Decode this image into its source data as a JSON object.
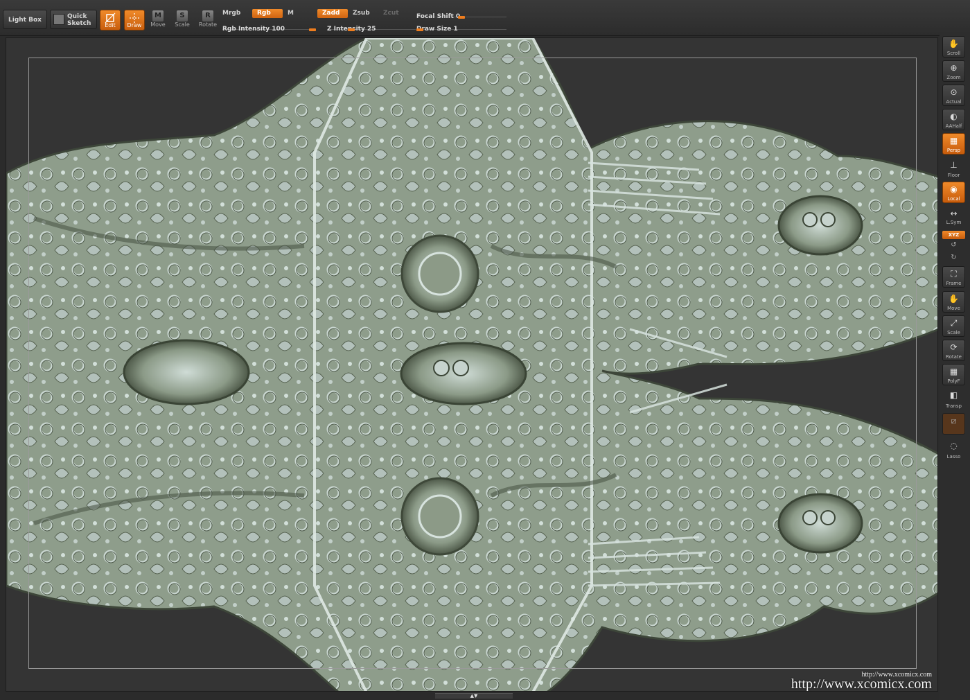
{
  "toolbar": {
    "light_box": "Light Box",
    "quick_sketch_line1": "Quick",
    "quick_sketch_line2": "Sketch",
    "edit": "Edit",
    "draw": "Draw",
    "move": "Move",
    "scale": "Scale",
    "rotate": "Rotate",
    "move_glyph": "M",
    "scale_glyph": "S",
    "rotate_glyph": "R",
    "mrgb": "Mrgb",
    "rgb": "Rgb",
    "m": "M",
    "zadd": "Zadd",
    "zsub": "Zsub",
    "zcut": "Zcut",
    "rgb_intensity": "Rgb Intensity 100",
    "z_intensity": "Z Intensity 25",
    "focal_shift": "Focal Shift 0",
    "draw_size": "Draw Size 1"
  },
  "slider_values": {
    "rgb_intensity": 100,
    "z_intensity": 25,
    "focal_shift": 0,
    "draw_size": 1
  },
  "shelf": {
    "scroll": "Scroll",
    "zoom": "Zoom",
    "actual": "Actual",
    "aahalf": "AAHalf",
    "persp": "Persp",
    "floor": "Floor",
    "local": "Local",
    "lsym": "L.Sym",
    "xyz": "XYZ",
    "frame": "Frame",
    "move": "Move",
    "scale": "Scale",
    "rotate": "Rotate",
    "polyf": "PolyF",
    "transp": "Transp",
    "lasso": "Lasso"
  },
  "watermark": {
    "small": "http://www.xcomicx.com",
    "big": "http://www.xcomicx.com"
  },
  "icons": [
    "hand-icon",
    "magnifier-icon",
    "perspective-icon",
    "floor-icon",
    "local-icon",
    "symmetry-icon",
    "frame-icon",
    "move-icon",
    "scale-icon",
    "rotate-icon",
    "polyframe-icon",
    "transparency-icon",
    "lasso-icon",
    "edit-icon",
    "draw-icon"
  ],
  "colors": {
    "accent": "#ee7d1e",
    "model_base": "#8d9c8a",
    "canvas_bg": "#343434"
  }
}
